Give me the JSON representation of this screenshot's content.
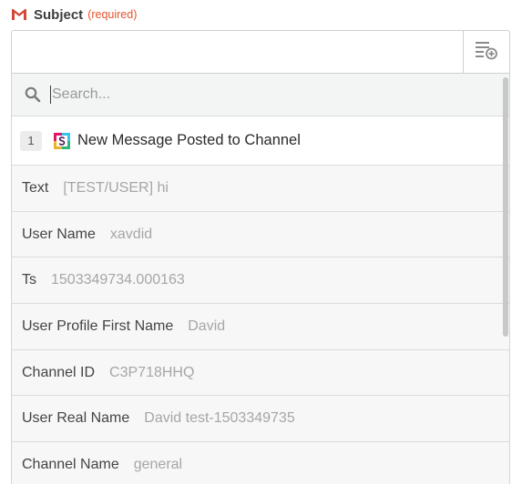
{
  "field": {
    "label": "Subject",
    "required_text": "(required)",
    "value": ""
  },
  "search": {
    "placeholder": "Search...",
    "value": ""
  },
  "step": {
    "number": "1",
    "app_icon": "slack-icon",
    "title": "New Message Posted to Channel"
  },
  "fields": [
    {
      "label": "Text",
      "value": "[TEST/USER] hi"
    },
    {
      "label": "User Name",
      "value": "xavdid"
    },
    {
      "label": "Ts",
      "value": "1503349734.000163"
    },
    {
      "label": "User Profile First Name",
      "value": "David"
    },
    {
      "label": "Channel ID",
      "value": "C3P718HHQ"
    },
    {
      "label": "User Real Name",
      "value": "David test-1503349735"
    },
    {
      "label": "Channel Name",
      "value": "general"
    }
  ],
  "colors": {
    "required": "#e5532d",
    "gmail_red": "#d44638"
  }
}
